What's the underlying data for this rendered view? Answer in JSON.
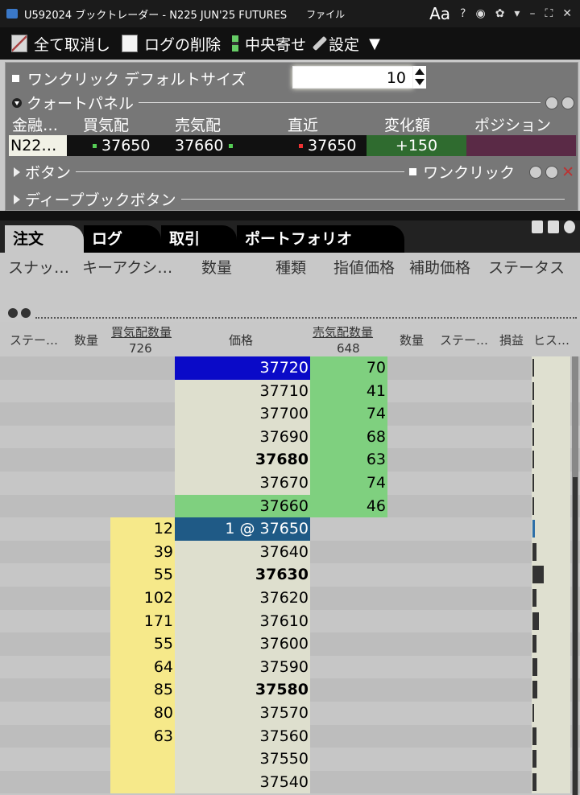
{
  "title_bar": {
    "title": "U592024 ブックトレーダー - N225 JUN'25 FUTURES",
    "file_menu": "ファイル",
    "font_button": "Aa",
    "help": "?"
  },
  "toolbar": {
    "cancel_all": "全て取消し",
    "delete_log": "ログの削除",
    "center": "中央寄せ",
    "settings": "設定"
  },
  "quote_panel": {
    "one_click_default_label": "ワンクリック デフォルトサイズ",
    "default_size": "10",
    "title": "クォートパネル",
    "columns": [
      "金融…",
      "買気配",
      "売気配",
      "直近",
      "変化額",
      "ポジション"
    ],
    "row": {
      "symbol": "N22…",
      "bid": "37650",
      "ask": "37660",
      "last": "37650",
      "change": "+150",
      "position": ""
    },
    "buttons_label": "ボタン",
    "one_click_label": "ワンクリック",
    "deep_book_label": "ディープブックボタン"
  },
  "tabs": [
    "注文",
    "ログ",
    "取引",
    "ポートフォリオ"
  ],
  "order_columns": [
    "スナッ…",
    "キーアクシ…",
    "数量",
    "種類",
    "指値価格",
    "補助価格",
    "ステータス"
  ],
  "book": {
    "headers": {
      "status_left": "ステー…",
      "qty_left": "数量",
      "bid_size": "買気配数量",
      "bid_total": "726",
      "price": "価格",
      "ask_size": "売気配数量",
      "ask_total": "648",
      "qty_right": "数量",
      "status_right": "ステー…",
      "pnl": "損益",
      "histogram": "ヒス…"
    },
    "rows": [
      {
        "bid": "",
        "price": "37720",
        "ask": "70",
        "bold": false,
        "hist": 0.0
      },
      {
        "bid": "",
        "price": "37710",
        "ask": "41",
        "bold": false,
        "hist": 0.1
      },
      {
        "bid": "",
        "price": "37700",
        "ask": "74",
        "bold": false,
        "hist": 0.15
      },
      {
        "bid": "",
        "price": "37690",
        "ask": "68",
        "bold": false,
        "hist": 0.1
      },
      {
        "bid": "",
        "price": "37680",
        "ask": "63",
        "bold": true,
        "hist": 0.1
      },
      {
        "bid": "",
        "price": "37670",
        "ask": "74",
        "bold": false,
        "hist": 0.1
      },
      {
        "bid": "",
        "price": "37660",
        "ask": "46",
        "bold": false,
        "hist": 0.0
      },
      {
        "bid": "12",
        "price": "1 @ 37650",
        "ask": "",
        "bold": false,
        "hist": 0.2
      },
      {
        "bid": "39",
        "price": "37640",
        "ask": "",
        "bold": false,
        "hist": 0.3
      },
      {
        "bid": "55",
        "price": "37630",
        "ask": "",
        "bold": true,
        "hist": 0.9
      },
      {
        "bid": "102",
        "price": "37620",
        "ask": "",
        "bold": false,
        "hist": 0.3
      },
      {
        "bid": "171",
        "price": "37610",
        "ask": "",
        "bold": false,
        "hist": 0.5
      },
      {
        "bid": "55",
        "price": "37600",
        "ask": "",
        "bold": false,
        "hist": 0.3
      },
      {
        "bid": "64",
        "price": "37590",
        "ask": "",
        "bold": false,
        "hist": 0.4
      },
      {
        "bid": "85",
        "price": "37580",
        "ask": "",
        "bold": true,
        "hist": 0.4
      },
      {
        "bid": "80",
        "price": "37570",
        "ask": "",
        "bold": false,
        "hist": 0.15
      },
      {
        "bid": "63",
        "price": "37560",
        "ask": "",
        "bold": false,
        "hist": 0.3
      },
      {
        "bid": "",
        "price": "37550",
        "ask": "",
        "bold": false,
        "hist": 0.3
      },
      {
        "bid": "",
        "price": "37540",
        "ask": "",
        "bold": false,
        "hist": 0.3
      }
    ]
  },
  "colors": {
    "bid_fill": "#f6e98a",
    "ask_fill": "#7fd07f",
    "best_ask_highlight": "#0a0ac8",
    "last_trade_highlight": "#1f5a86",
    "price_fill": "#dedfce"
  }
}
